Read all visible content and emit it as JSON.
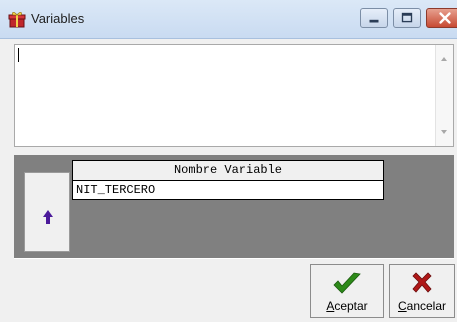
{
  "window": {
    "title": "Variables",
    "icon": "gift-icon",
    "controls": [
      "minimize",
      "maximize",
      "close"
    ]
  },
  "editor": {
    "value": "",
    "icon_up": "scroll-up-arrow",
    "icon_down": "scroll-down-arrow"
  },
  "side_button": {
    "icon": "up-arrow-icon"
  },
  "variables_table": {
    "columns": [
      "Nombre Variable"
    ],
    "rows": [
      [
        "NIT_TERCERO"
      ]
    ]
  },
  "actions": {
    "accept_label": "Aceptar",
    "cancel_label": "Cancelar",
    "accept_icon": "checkmark-icon",
    "cancel_icon": "x-icon"
  },
  "colors": {
    "gray_panel": "#808080",
    "accept_green": "#2d8a19",
    "cancel_red": "#b01818",
    "arrow_purple": "#4b1a9a"
  }
}
